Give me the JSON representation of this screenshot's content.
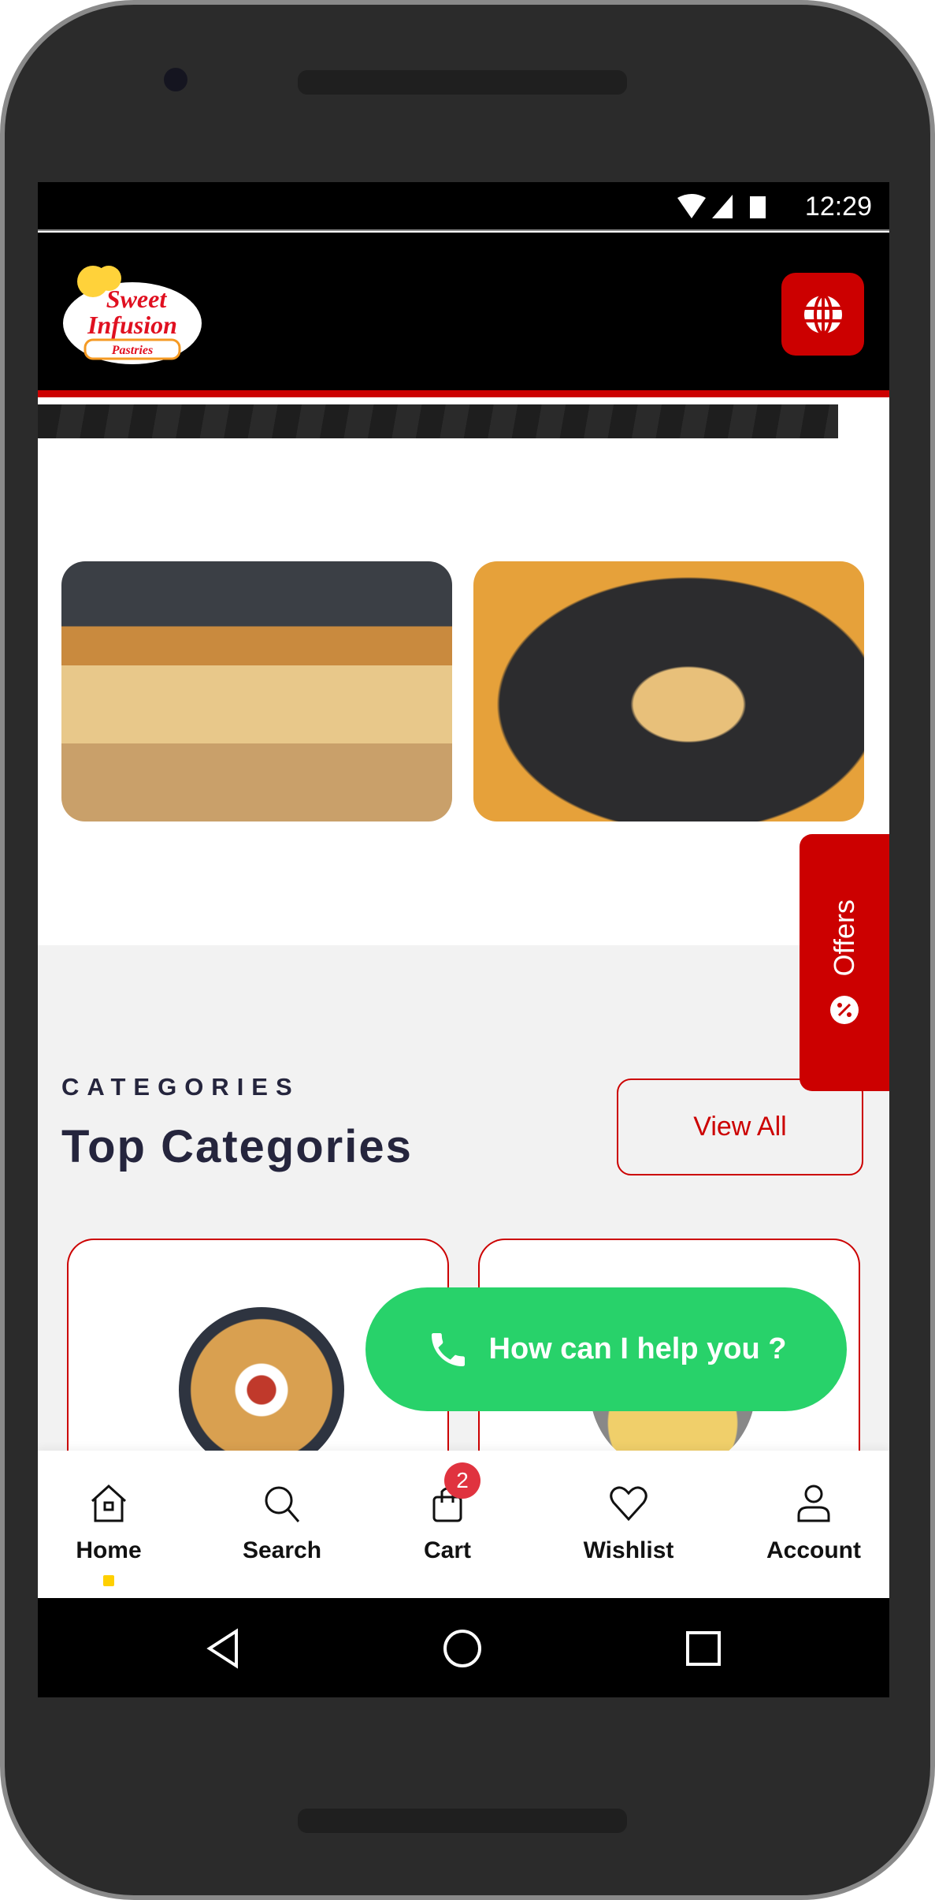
{
  "status_bar": {
    "time": "12:29"
  },
  "header": {
    "brand": "Sweet Infusion Pastries",
    "language_icon": "globe-icon",
    "accent": "#cc0000"
  },
  "categories": {
    "eyebrow": "CATEGORIES",
    "title": "Top Categories",
    "view_all": "View All"
  },
  "offers_tab": {
    "label": "Offers"
  },
  "help_button": {
    "label": "How can I help you ?",
    "color": "#28d26a"
  },
  "bottom_nav": {
    "items": [
      {
        "label": "Home",
        "icon": "home-icon",
        "active": true
      },
      {
        "label": "Search",
        "icon": "search-icon"
      },
      {
        "label": "Cart",
        "icon": "bag-icon",
        "badge": "2"
      },
      {
        "label": "Wishlist",
        "icon": "heart-icon"
      },
      {
        "label": "Account",
        "icon": "user-icon"
      }
    ]
  }
}
